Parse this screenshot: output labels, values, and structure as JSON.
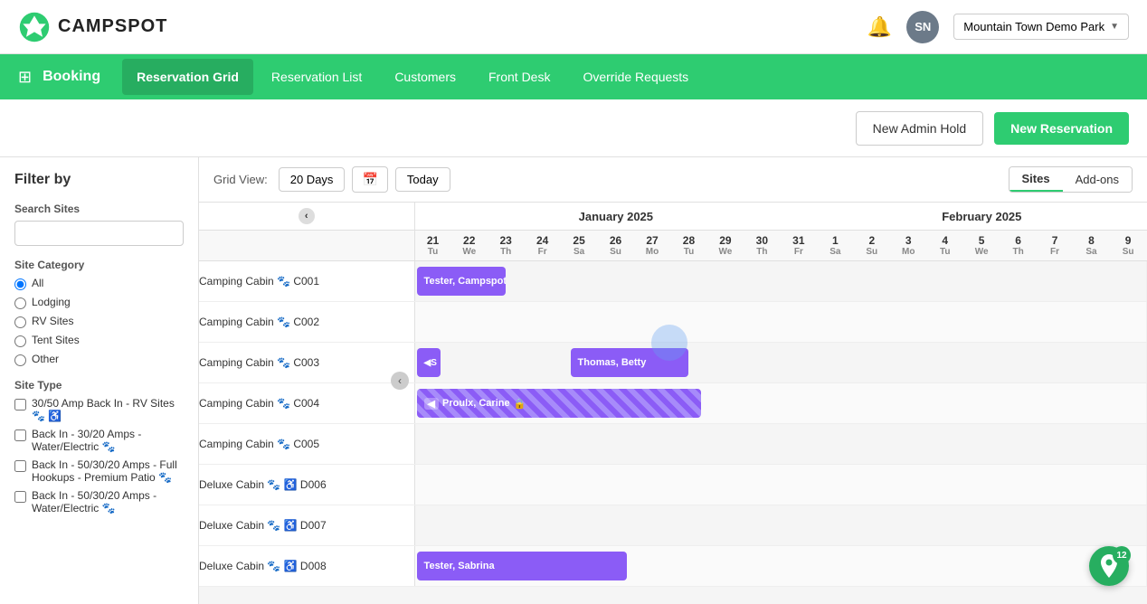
{
  "app": {
    "logo_text": "CAMPSPOT",
    "avatar_initials": "SN",
    "park_name": "Mountain Town Demo Park"
  },
  "nav": {
    "booking_label": "Booking",
    "tabs": [
      {
        "id": "reservation-grid",
        "label": "Reservation Grid",
        "active": true
      },
      {
        "id": "reservation-list",
        "label": "Reservation List",
        "active": false
      },
      {
        "id": "customers",
        "label": "Customers",
        "active": false
      },
      {
        "id": "front-desk",
        "label": "Front Desk",
        "active": false
      },
      {
        "id": "override-requests",
        "label": "Override Requests",
        "active": false
      }
    ]
  },
  "actions": {
    "admin_hold_label": "New Admin Hold",
    "new_reservation_label": "New Reservation"
  },
  "sidebar": {
    "filter_title": "Filter by",
    "search_sites_label": "Search Sites",
    "search_placeholder": "",
    "site_category_label": "Site Category",
    "site_categories": [
      {
        "id": "all",
        "label": "All",
        "checked": true
      },
      {
        "id": "lodging",
        "label": "Lodging",
        "checked": false
      },
      {
        "id": "rv-sites",
        "label": "RV Sites",
        "checked": false
      },
      {
        "id": "tent-sites",
        "label": "Tent Sites",
        "checked": false
      },
      {
        "id": "other",
        "label": "Other",
        "checked": false
      }
    ],
    "site_type_label": "Site Type",
    "site_types": [
      {
        "id": "type1",
        "label": "30/50 Amp Back In - RV Sites 🐾 ♿",
        "checked": false
      },
      {
        "id": "type2",
        "label": "Back In - 30/20 Amps - Water/Electric 🐾",
        "checked": false
      },
      {
        "id": "type3",
        "label": "Back In - 50/30/20 Amps - Full Hookups - Premium Patio 🐾",
        "checked": false
      },
      {
        "id": "type4",
        "label": "Back In - 50/30/20 Amps - Water/Electric 🐾",
        "checked": false
      }
    ]
  },
  "grid": {
    "view_label": "Grid View:",
    "days_value": "20 Days",
    "today_label": "Today",
    "toggle_sites": "Sites",
    "toggle_addons": "Add-ons",
    "month_jan": "January 2025",
    "month_feb": "February 2025",
    "jan_days": [
      {
        "num": "21",
        "name": "Tu"
      },
      {
        "num": "22",
        "name": "We"
      },
      {
        "num": "23",
        "name": "Th"
      },
      {
        "num": "24",
        "name": "Fr"
      },
      {
        "num": "25",
        "name": "Sa"
      },
      {
        "num": "26",
        "name": "Su"
      },
      {
        "num": "27",
        "name": "Mo"
      },
      {
        "num": "28",
        "name": "Tu"
      },
      {
        "num": "29",
        "name": "We"
      },
      {
        "num": "30",
        "name": "Th"
      },
      {
        "num": "31",
        "name": "Fr"
      }
    ],
    "feb_days": [
      {
        "num": "1",
        "name": "Sa"
      },
      {
        "num": "2",
        "name": "Su"
      },
      {
        "num": "3",
        "name": "Mo"
      },
      {
        "num": "4",
        "name": "Tu"
      },
      {
        "num": "5",
        "name": "We"
      },
      {
        "num": "6",
        "name": "Th"
      },
      {
        "num": "7",
        "name": "Fr"
      },
      {
        "num": "8",
        "name": "Sa"
      },
      {
        "num": "9",
        "name": "Su"
      }
    ],
    "sites": [
      {
        "id": "c001",
        "name": "Camping Cabin 🐾 C001",
        "reservations": [
          {
            "label": "Tester, Campspot",
            "start": 0,
            "span": 3,
            "type": "solid"
          }
        ]
      },
      {
        "id": "c002",
        "name": "Camping Cabin 🐾 C002",
        "reservations": []
      },
      {
        "id": "c003",
        "name": "Camping Cabin 🐾 C003",
        "reservations": [
          {
            "label": "S",
            "start": 0,
            "span": 1,
            "type": "solid",
            "partial": true
          },
          {
            "label": "Thomas, Betty",
            "start": 5,
            "span": 4,
            "type": "solid"
          }
        ]
      },
      {
        "id": "c004",
        "name": "Camping Cabin 🐾 C004",
        "reservations": [
          {
            "label": "Proulx, Carine",
            "start": 0,
            "span": 10,
            "type": "striped",
            "lock": true
          }
        ]
      },
      {
        "id": "c005",
        "name": "Camping Cabin 🐾 C005",
        "reservations": []
      },
      {
        "id": "d006",
        "name": "Deluxe Cabin 🐾 ♿ D006",
        "reservations": []
      },
      {
        "id": "d007",
        "name": "Deluxe Cabin 🐾 ♿ D007",
        "reservations": []
      },
      {
        "id": "d008",
        "name": "Deluxe Cabin 🐾 ♿ D008",
        "reservations": [
          {
            "label": "Tester, Sabrina",
            "start": 0,
            "span": 7,
            "type": "solid"
          }
        ]
      }
    ]
  },
  "map_pin_count": "12"
}
